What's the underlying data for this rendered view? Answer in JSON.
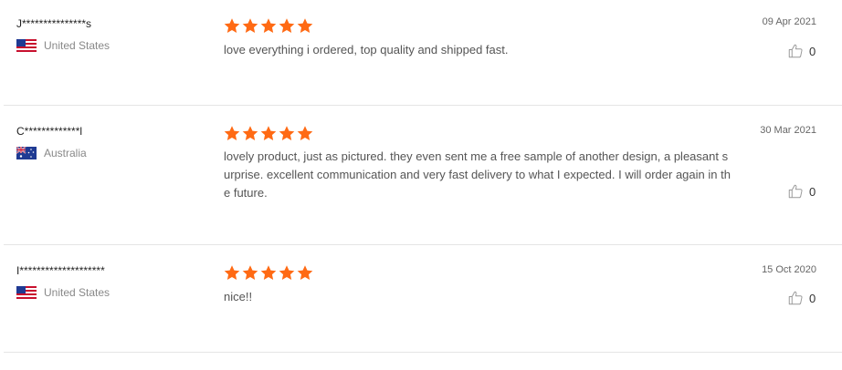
{
  "reviews": [
    {
      "user": "J***************s",
      "country": "United States",
      "flag": "us-flag-icon",
      "rating": 5,
      "text": "love everything i ordered, top quality and shipped fast.",
      "date": "09 Apr 2021",
      "likes": "0"
    },
    {
      "user": "C*************l",
      "country": "Australia",
      "flag": "au-flag-icon",
      "rating": 5,
      "text": "lovely product, just as pictured. they even sent me a free sample of another design, a pleasant surprise. excellent communication and very fast delivery to what I expected. I will order again in the future.",
      "date": "30 Mar 2021",
      "likes": "0"
    },
    {
      "user": "I********************",
      "country": "United States",
      "flag": "us-flag-icon",
      "rating": 5,
      "text": "nice!!",
      "date": "15 Oct 2020",
      "likes": "0"
    }
  ],
  "colors": {
    "star": "#ff6a14",
    "divider": "#e5e5e5"
  }
}
